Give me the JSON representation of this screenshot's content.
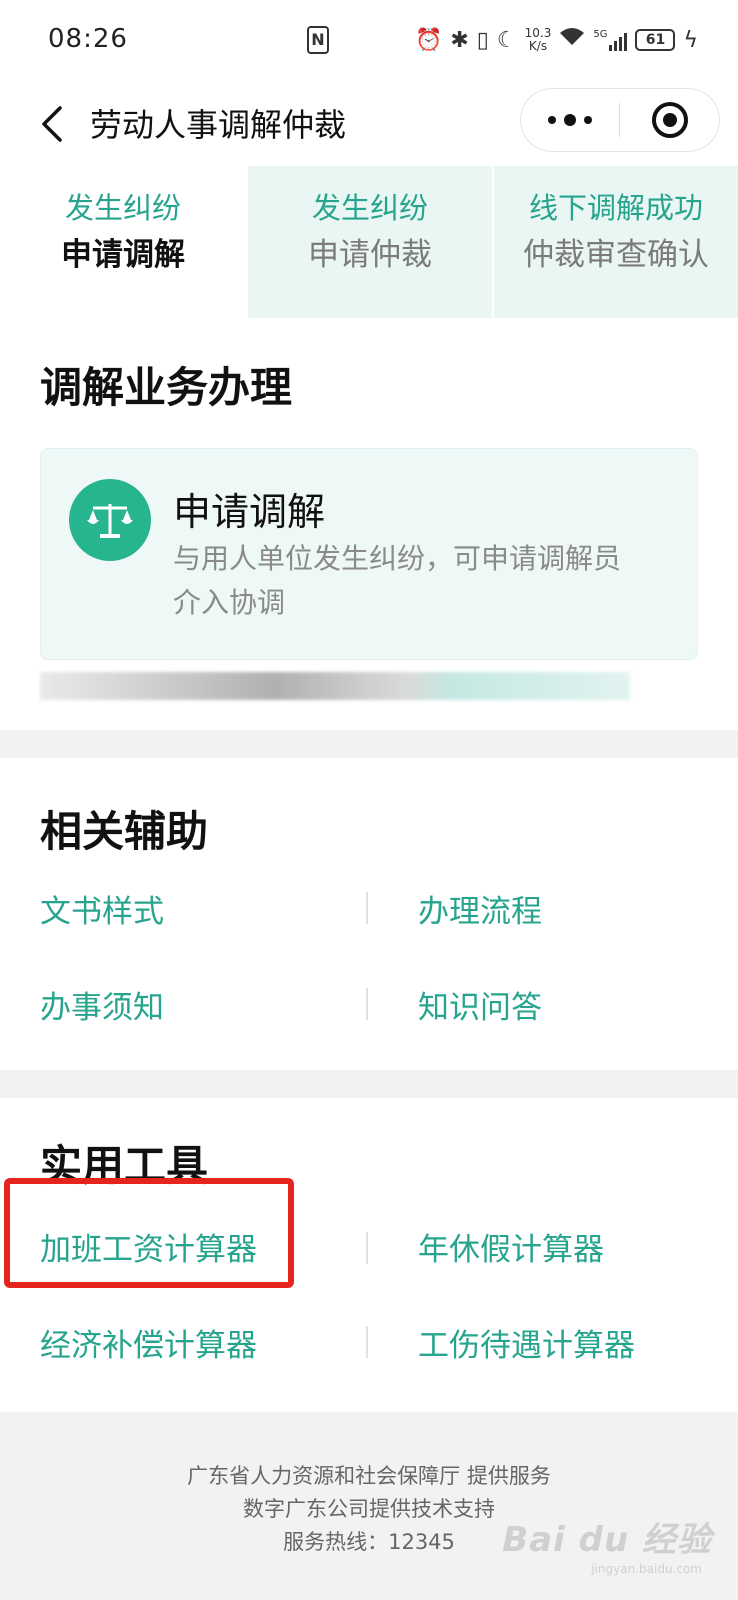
{
  "status_bar": {
    "time": "08:26",
    "nfc": "N",
    "net_speed_value": "10.3",
    "net_speed_unit": "K/s",
    "signal_label": "5G",
    "battery": "61",
    "icons": [
      "alarm-icon",
      "bluetooth-icon",
      "vibrate-icon",
      "moon-icon",
      "wifi-icon",
      "signal-icon",
      "charging-icon"
    ]
  },
  "nav": {
    "title": "劳动人事调解仲裁"
  },
  "tabs": [
    {
      "line1": "发生纠纷",
      "line2": "申请调解",
      "active": true
    },
    {
      "line1": "发生纠纷",
      "line2": "申请仲裁",
      "active": false
    },
    {
      "line1": "线下调解成功",
      "line2": "仲裁审查确认",
      "active": false
    }
  ],
  "mediation": {
    "section_title": "调解业务办理",
    "card_title": "申请调解",
    "card_desc_line1": "与用人单位发生纠纷，可申请调解员",
    "card_desc_line2": "介入协调",
    "icon": "scale-icon"
  },
  "assist": {
    "section_title": "相关辅助",
    "links": [
      "文书样式",
      "办理流程",
      "办事须知",
      "知识问答"
    ]
  },
  "tools": {
    "section_title": "实用工具",
    "links": [
      "加班工资计算器",
      "年休假计算器",
      "经济补偿计算器",
      "工伤待遇计算器"
    ]
  },
  "footer": {
    "line1": "广东省人力资源和社会保障厅 提供服务",
    "line2": "数字广东公司提供技术支持",
    "line3": "服务热线：12345"
  },
  "watermark": {
    "text": "Bai du 经验",
    "sub": "jingyan.baidu.com"
  },
  "colors": {
    "accent": "#27a48d",
    "highlight": "#e5251d",
    "icon_bg": "#27b58f"
  }
}
